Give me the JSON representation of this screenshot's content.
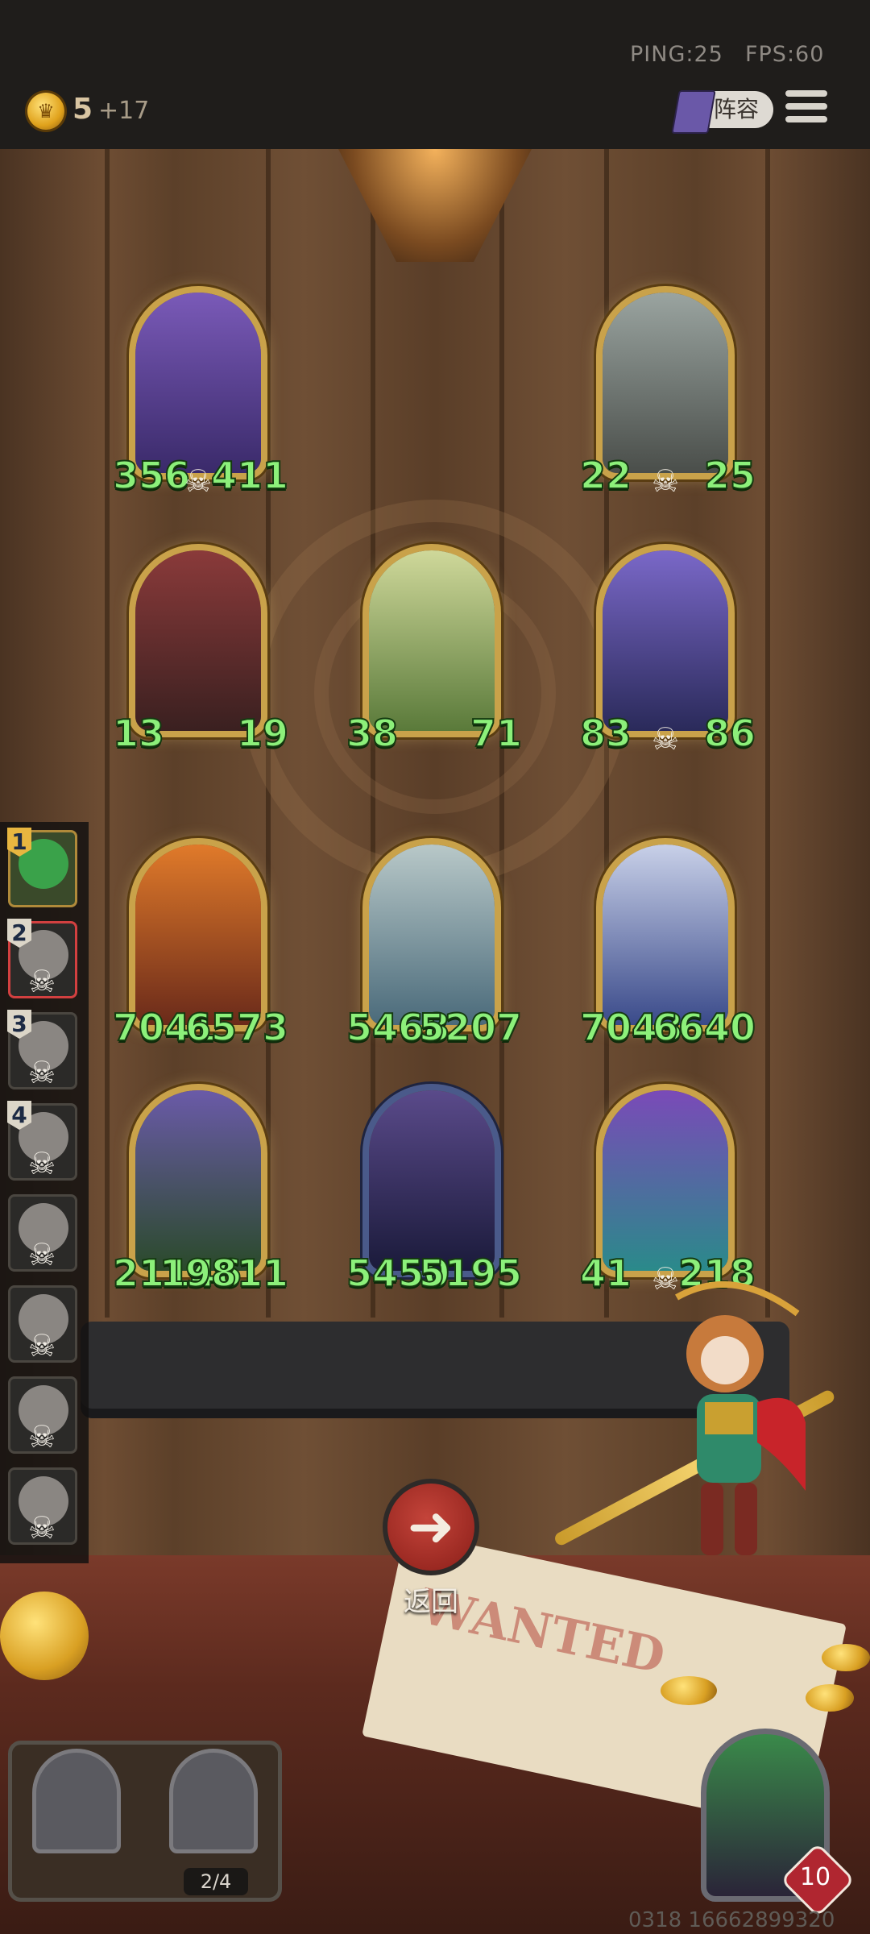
{
  "status": {
    "ping": "PING:25",
    "fps": "FPS:60"
  },
  "currency": {
    "amount": "5",
    "income": "+17"
  },
  "header": {
    "lineup_label": "阵容"
  },
  "board": {
    "rows": [
      [
        {
          "left": "356",
          "right": "411",
          "skull": true,
          "border": "gold",
          "art": "dragon"
        },
        null,
        {
          "left": "22",
          "right": "25",
          "skull": true,
          "border": "gold",
          "art": "brute"
        }
      ],
      [
        {
          "left": "13",
          "right": "19",
          "skull": false,
          "border": "gold",
          "art": "king"
        },
        {
          "left": "38",
          "right": "71",
          "skull": false,
          "border": "gold",
          "art": "dryad"
        },
        {
          "left": "83",
          "right": "86",
          "skull": true,
          "border": "gold",
          "art": "wizard"
        }
      ],
      [
        {
          "left": "7041",
          "right": "6573",
          "skull": false,
          "border": "gold",
          "art": "hood"
        },
        {
          "left": "5468",
          "right": "5207",
          "skull": false,
          "border": "gold",
          "art": "ice-dragon"
        },
        {
          "left": "7043",
          "right": "6640",
          "skull": false,
          "border": "gold",
          "art": "mage"
        }
      ],
      [
        {
          "left": "21146",
          "right": "19811",
          "skull": false,
          "border": "gold",
          "art": "pumpkin"
        },
        {
          "left": "5450",
          "right": "5195",
          "skull": false,
          "border": "blue",
          "art": "dark-queen"
        },
        {
          "left": "41",
          "right": "218",
          "skull": true,
          "border": "gold",
          "art": "ghost-knight"
        }
      ]
    ]
  },
  "sidebar": {
    "players": [
      {
        "rank": "1",
        "selected": false,
        "alive": true
      },
      {
        "rank": "2",
        "selected": true,
        "alive": false
      },
      {
        "rank": "3",
        "selected": false,
        "alive": false
      },
      {
        "rank": "4",
        "selected": false,
        "alive": false
      },
      {
        "rank": "",
        "selected": false,
        "alive": false
      },
      {
        "rank": "",
        "selected": false,
        "alive": false
      },
      {
        "rank": "",
        "selected": false,
        "alive": false
      },
      {
        "rank": "",
        "selected": false,
        "alive": false
      }
    ]
  },
  "controls": {
    "back_label": "返回",
    "back_icon": "arrow-left-icon"
  },
  "bench": {
    "count": "2/4"
  },
  "player": {
    "level": "10"
  },
  "footer": {
    "serial": "0318 16662899320"
  },
  "colors": {
    "number_green": "#8cf07a",
    "gold_border": "#c9a24a",
    "back_red": "#b0302a"
  }
}
